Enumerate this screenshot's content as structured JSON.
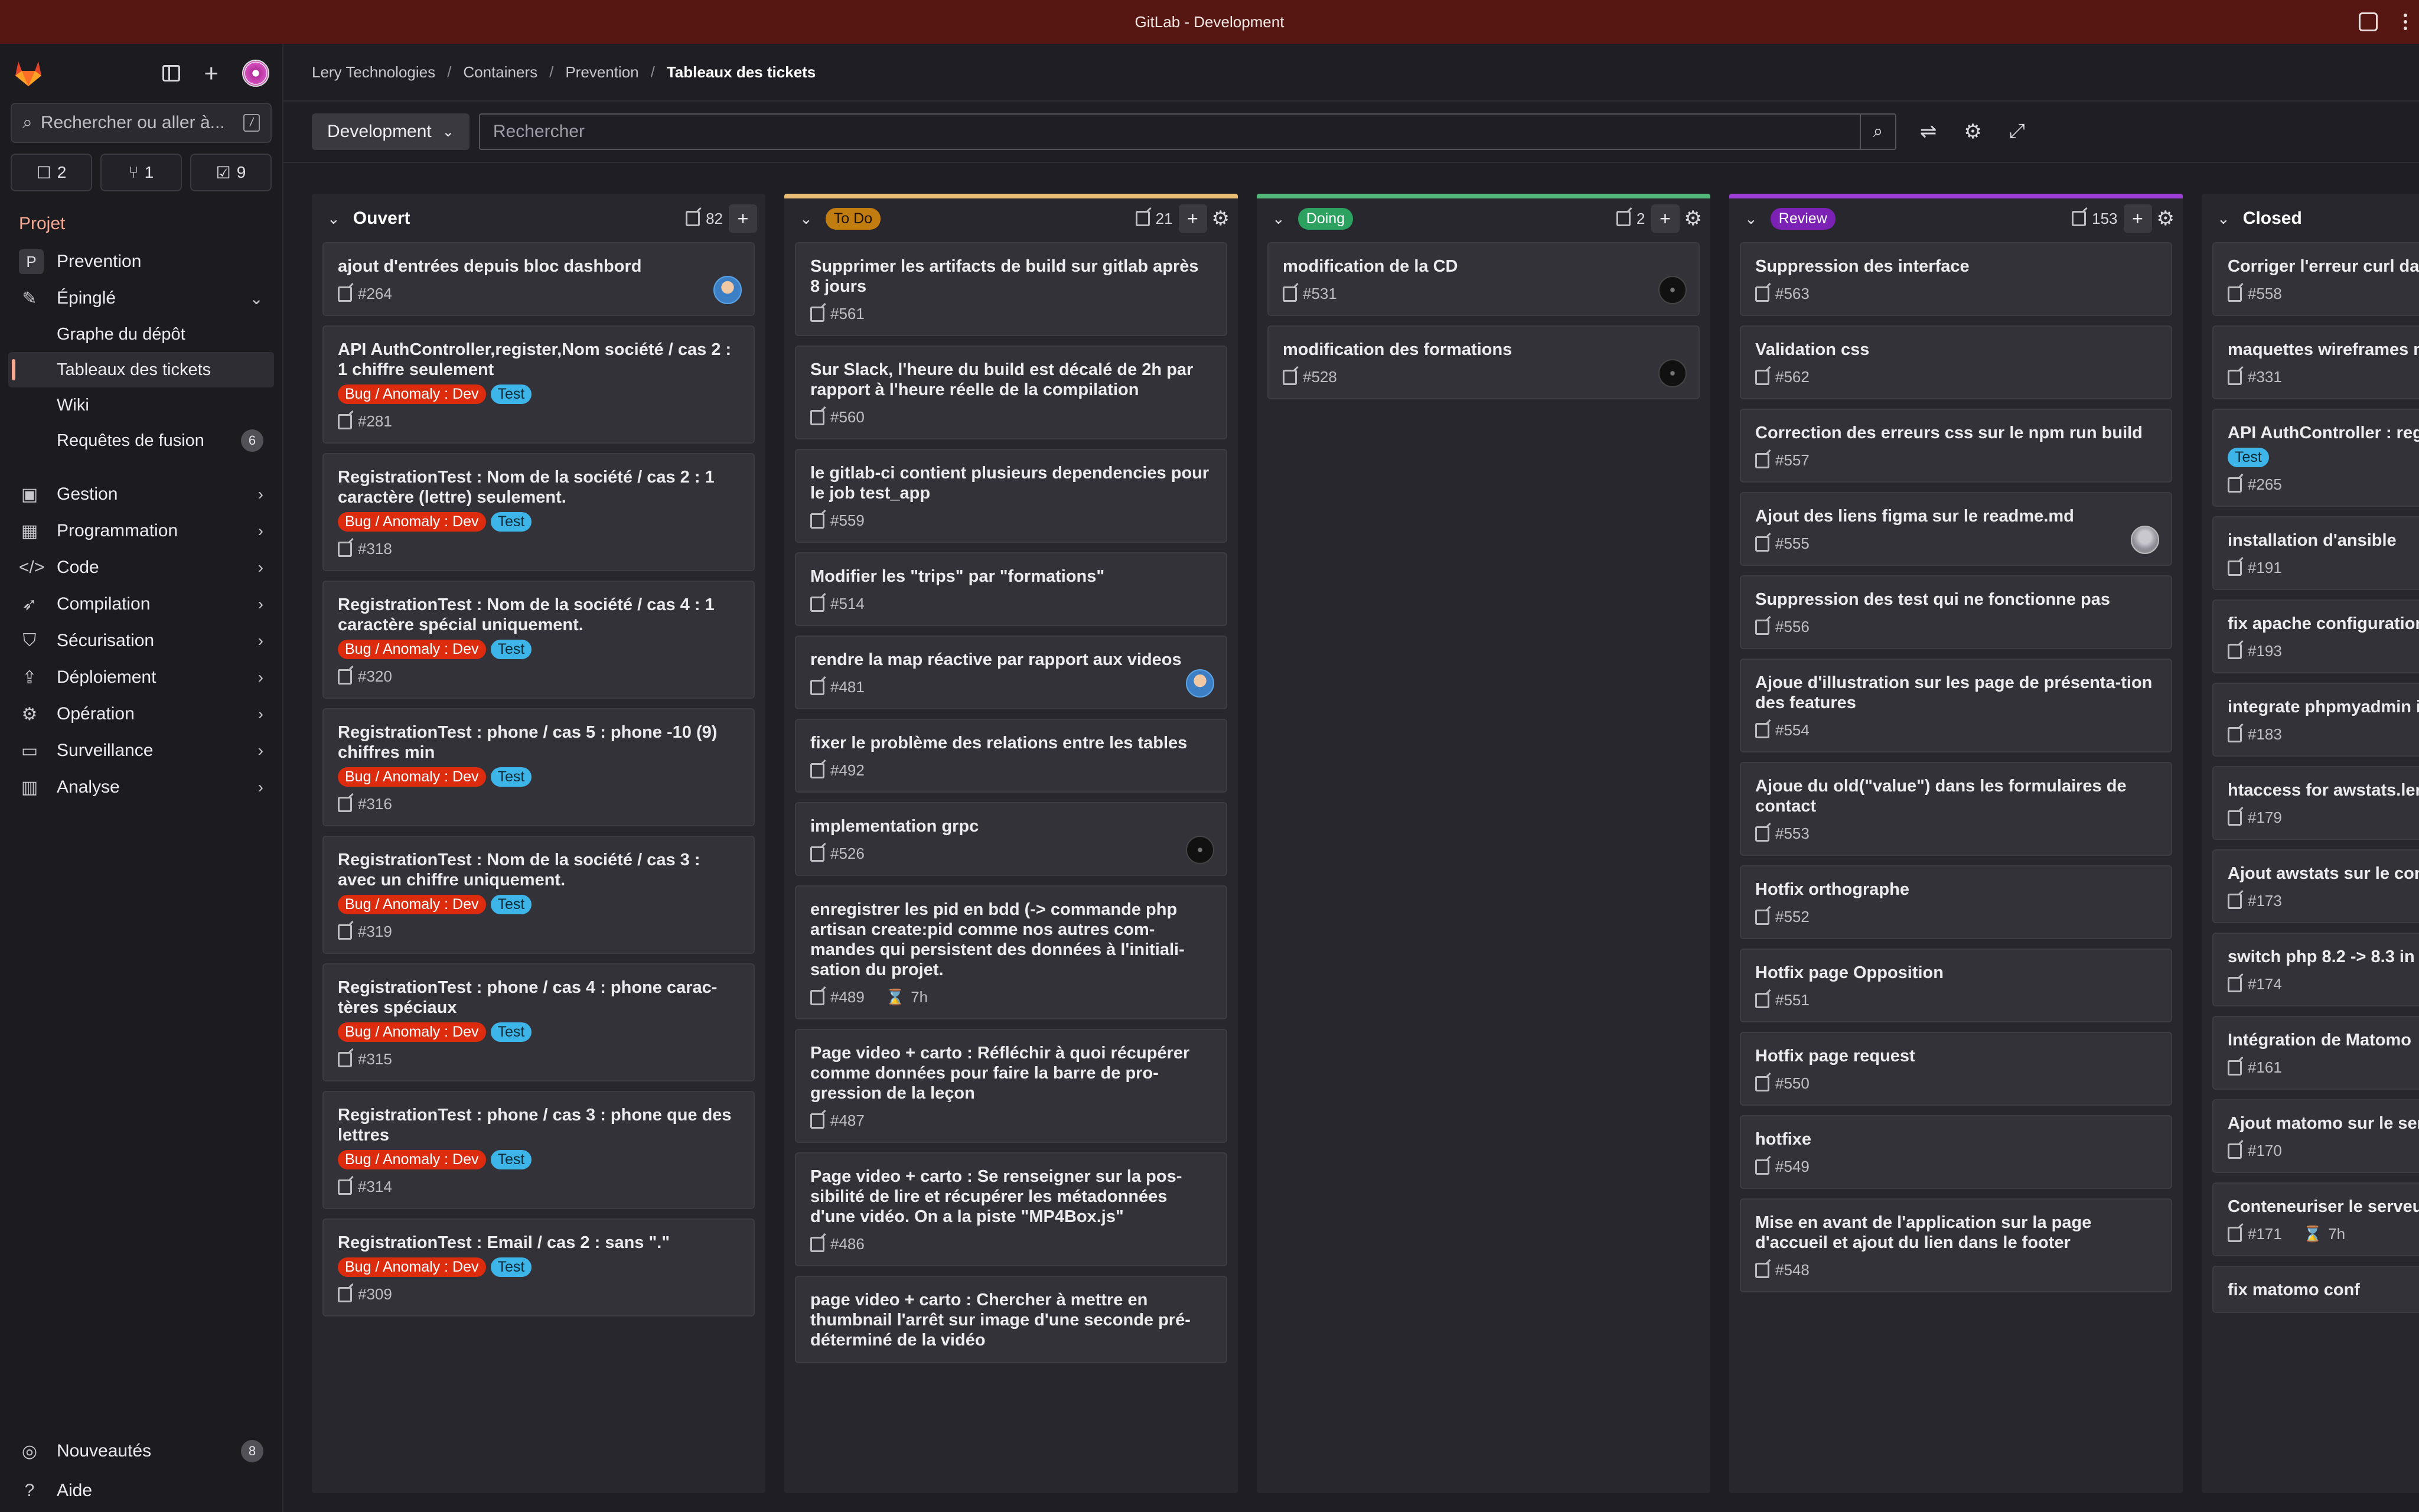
{
  "window_title": "GitLab - Development",
  "sidebar": {
    "search_placeholder": "Rechercher ou aller à...",
    "slash_key": "/",
    "counts": {
      "issues": "2",
      "merge_requests": "1",
      "todos": "9"
    },
    "section_title": "Projet",
    "project": {
      "letter": "P",
      "name": "Prevention"
    },
    "pinned": {
      "label": "Épinglé",
      "items": [
        {
          "label": "Graphe du dépôt"
        },
        {
          "label": "Tableaux des tickets"
        },
        {
          "label": "Wiki"
        },
        {
          "label": "Requêtes de fusion",
          "badge": "6"
        }
      ]
    },
    "nav": [
      {
        "label": "Gestion"
      },
      {
        "label": "Programmation"
      },
      {
        "label": "Code"
      },
      {
        "label": "Compilation"
      },
      {
        "label": "Sécurisation"
      },
      {
        "label": "Déploiement"
      },
      {
        "label": "Opération"
      },
      {
        "label": "Surveillance"
      },
      {
        "label": "Analyse"
      }
    ],
    "bottom": {
      "news_label": "Nouveautés",
      "news_badge": "8",
      "help_label": "Aide"
    }
  },
  "breadcrumb": [
    "Lery Technologies",
    "Containers",
    "Prevention",
    "Tableaux des tickets"
  ],
  "filterbar": {
    "board_select": "Development",
    "search_placeholder": "Rechercher"
  },
  "columns": [
    {
      "title": "Ouvert",
      "count": "82",
      "cards": [
        {
          "title": "ajout d'entrées depuis bloc dashbord",
          "id": "#264",
          "avatar": "boy"
        },
        {
          "title": "API AuthController,register,Nom société / cas 2 : 1 chiffre seulement",
          "labels": [
            "Bug / Anomaly : Dev",
            "Test"
          ],
          "id": "#281"
        },
        {
          "title": "RegistrationTest : Nom de la société / cas 2 : 1 caractère (lettre) seulement.",
          "labels": [
            "Bug / Anomaly : Dev",
            "Test"
          ],
          "id": "#318"
        },
        {
          "title": "RegistrationTest : Nom de la société / cas 4 : 1 caractère spécial uniquement.",
          "labels": [
            "Bug / Anomaly : Dev",
            "Test"
          ],
          "id": "#320"
        },
        {
          "title": "RegistrationTest : phone / cas 5 : phone -10 (9) chiffres min",
          "labels": [
            "Bug / Anomaly : Dev",
            "Test"
          ],
          "id": "#316"
        },
        {
          "title": "RegistrationTest : Nom de la société / cas 3 : avec un chiffre uniquement.",
          "labels": [
            "Bug / Anomaly : Dev",
            "Test"
          ],
          "id": "#319"
        },
        {
          "title": "RegistrationTest : phone / cas 4 : phone carac-tères spéciaux",
          "labels": [
            "Bug / Anomaly : Dev",
            "Test"
          ],
          "id": "#315"
        },
        {
          "title": "RegistrationTest : phone / cas 3 : phone que des lettres",
          "labels": [
            "Bug / Anomaly : Dev",
            "Test"
          ],
          "id": "#314"
        },
        {
          "title": "RegistrationTest : Email / cas 2 : sans \".\"",
          "labels": [
            "Bug / Anomaly : Dev",
            "Test"
          ],
          "id": "#309"
        }
      ]
    },
    {
      "title": "To Do",
      "count": "21",
      "color": "#e9be74",
      "pill_bg": "#c17d10",
      "pill_fg": "#1b1102",
      "cards": [
        {
          "title": "Supprimer les artifacts de build sur gitlab après 8 jours",
          "id": "#561"
        },
        {
          "title": "Sur Slack, l'heure du build est décalé de 2h par rapport à l'heure réelle de la compilation",
          "id": "#560"
        },
        {
          "title": "le gitlab-ci contient plusieurs dependencies pour le job test_app",
          "id": "#559"
        },
        {
          "title": "Modifier les \"trips\" par \"formations\"",
          "id": "#514"
        },
        {
          "title": "rendre la map réactive par rapport aux videos",
          "id": "#481",
          "avatar": "boy"
        },
        {
          "title": "fixer le problème des relations entre les tables",
          "id": "#492"
        },
        {
          "title": "implementation grpc",
          "id": "#526",
          "avatar": "dark"
        },
        {
          "title": "enregistrer les pid en bdd (-> commande php artisan create:pid comme nos autres com-mandes qui persistent des données à l'initiali-sation du projet.",
          "id": "#489",
          "time": "7h"
        },
        {
          "title": "Page video + carto : Réfléchir à quoi récupérer comme données pour faire la barre de pro-gression de la leçon",
          "id": "#487"
        },
        {
          "title": "Page video + carto : Se renseigner sur la pos-sibilité de lire et récupérer les métadonnées d'une vidéo. On a la piste \"MP4Box.js\"",
          "id": "#486"
        },
        {
          "title": "page video + carto : Chercher à mettre en thumbnail l'arrêt sur image d'une seconde pré-déterminé de la vidéo",
          "id": ""
        }
      ]
    },
    {
      "title": "Doing",
      "count": "2",
      "color": "#52b87a",
      "pill_bg": "#2da160",
      "pill_fg": "#ffffff",
      "cards": [
        {
          "title": "modification de la CD",
          "id": "#531",
          "avatar": "dark"
        },
        {
          "title": "modification des formations",
          "id": "#528",
          "avatar": "dark"
        }
      ]
    },
    {
      "title": "Review",
      "count": "153",
      "color": "#9d3fd6",
      "pill_bg": "#7b22b4",
      "pill_fg": "#ffffff",
      "cards": [
        {
          "title": "Suppression des interface",
          "id": "#563"
        },
        {
          "title": "Validation css",
          "id": "#562"
        },
        {
          "title": "Correction des erreurs css sur le npm run build",
          "id": "#557"
        },
        {
          "title": "Ajout des liens figma sur le readme.md",
          "id": "#555",
          "avatar": "gray"
        },
        {
          "title": "Suppression des test qui ne fonctionne pas",
          "id": "#556"
        },
        {
          "title": "Ajoue d'illustration sur les page de présenta-tion des features",
          "id": "#554"
        },
        {
          "title": "Ajoue du old(\"value\") dans les formulaires de contact",
          "id": "#553"
        },
        {
          "title": "Hotfix orthographe",
          "id": "#552"
        },
        {
          "title": "Hotfix page Opposition",
          "id": "#551"
        },
        {
          "title": "Hotfix page request",
          "id": "#550"
        },
        {
          "title": "hotfixe",
          "id": "#549"
        },
        {
          "title": "Mise en avant de l'application sur la page d'accueil et ajout du lien dans le footer",
          "id": "#548"
        }
      ]
    },
    {
      "title": "Closed",
      "cards": [
        {
          "title": "Corriger l'erreur curl dar",
          "id": "#558"
        },
        {
          "title": "maquettes wireframes m",
          "id": "#331"
        },
        {
          "title": "API AuthController : regi",
          "labels": [
            "Test"
          ],
          "id": "#265"
        },
        {
          "title": "installation d'ansible",
          "id": "#191"
        },
        {
          "title": "fix apache configuration",
          "id": "#193"
        },
        {
          "title": "integrate phpmyadmin in",
          "id": "#183"
        },
        {
          "title": "htaccess for awstats.ler",
          "id": "#179"
        },
        {
          "title": "Ajout awstats sur le con",
          "id": "#173"
        },
        {
          "title": "switch php 8.2 -> 8.3 in",
          "id": "#174"
        },
        {
          "title": "Intégration de Matomo",
          "id": "#161"
        },
        {
          "title": "Ajout matomo sur le ser",
          "id": "#170"
        },
        {
          "title": "Conteneuriser le serveu",
          "id": "#171",
          "time": "7h"
        },
        {
          "title": "fix matomo conf",
          "id": ""
        }
      ]
    }
  ]
}
